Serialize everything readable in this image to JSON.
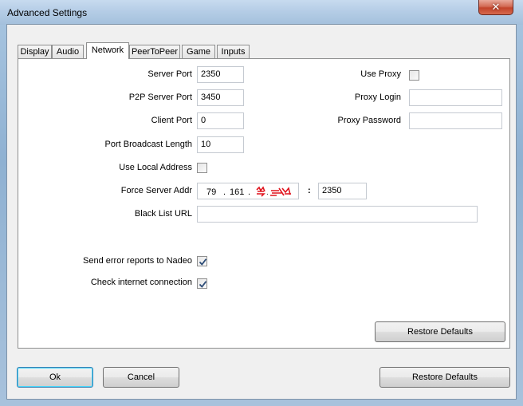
{
  "window": {
    "title": "Advanced Settings",
    "close_glyph": "✕"
  },
  "tabs": [
    "Display",
    "Audio",
    "Network",
    "PeerToPeer",
    "Game",
    "Inputs"
  ],
  "active_tab": "Network",
  "network": {
    "server_port_label": "Server Port",
    "server_port_value": "2350",
    "p2p_server_port_label": "P2P Server Port",
    "p2p_server_port_value": "3450",
    "client_port_label": "Client Port",
    "client_port_value": "0",
    "port_broadcast_length_label": "Port Broadcast Length",
    "port_broadcast_length_value": "10",
    "use_local_address_label": "Use Local Address",
    "use_local_address_checked": false,
    "force_server_addr_label": "Force Server Addr",
    "ip_octet1": "79",
    "ip_octet2": "161",
    "ip_dot": ".",
    "port_sep": ":",
    "force_server_port_value": "2350",
    "black_list_url_label": "Black List URL",
    "black_list_url_value": "",
    "use_proxy_label": "Use Proxy",
    "use_proxy_checked": false,
    "proxy_login_label": "Proxy Login",
    "proxy_login_value": "",
    "proxy_password_label": "Proxy Password",
    "proxy_password_value": "",
    "send_error_reports_label": "Send error reports to Nadeo",
    "send_error_reports_checked": true,
    "check_internet_label": "Check internet connection",
    "check_internet_checked": true,
    "restore_defaults_label": "Restore Defaults"
  },
  "footer": {
    "ok_label": "Ok",
    "cancel_label": "Cancel",
    "restore_defaults_label": "Restore Defaults"
  },
  "colors": {
    "redaction": "#e0141e",
    "close_button": "#c2432a",
    "default_button_border": "#3c7fb1"
  }
}
